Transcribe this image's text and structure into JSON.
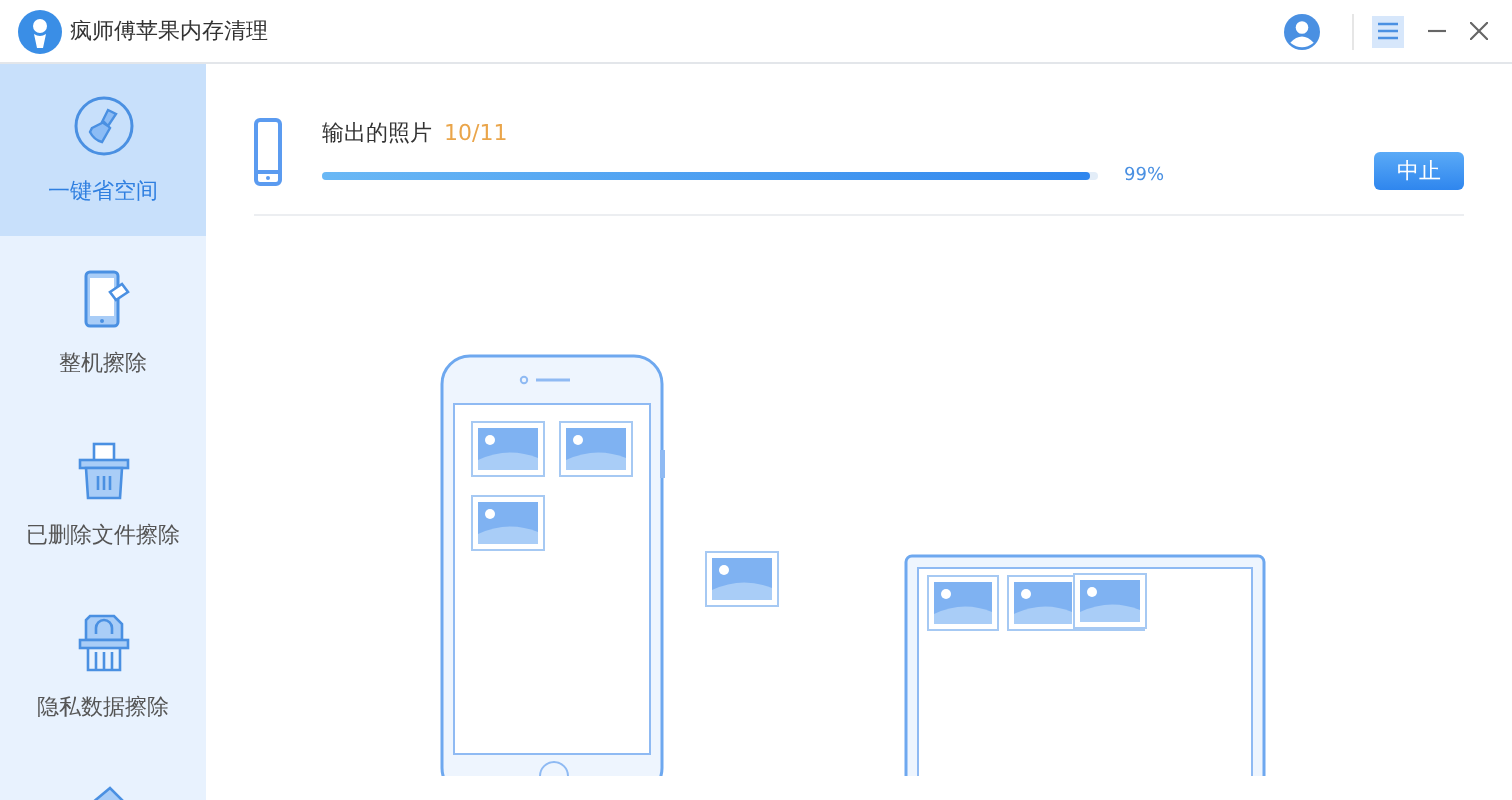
{
  "window": {
    "title": "疯师傅苹果内存清理"
  },
  "sidebar": {
    "items": [
      {
        "label": "一键省空间",
        "kind": "broom",
        "selected": true
      },
      {
        "label": "整机擦除",
        "kind": "phone-erase",
        "selected": false
      },
      {
        "label": "已删除文件擦除",
        "kind": "trash",
        "selected": false
      },
      {
        "label": "隐私数据擦除",
        "kind": "lock",
        "selected": false
      }
    ]
  },
  "progress": {
    "label": "输出的照片",
    "count": "10/11",
    "level": 0.99,
    "reading": "99%",
    "button": "中止"
  }
}
